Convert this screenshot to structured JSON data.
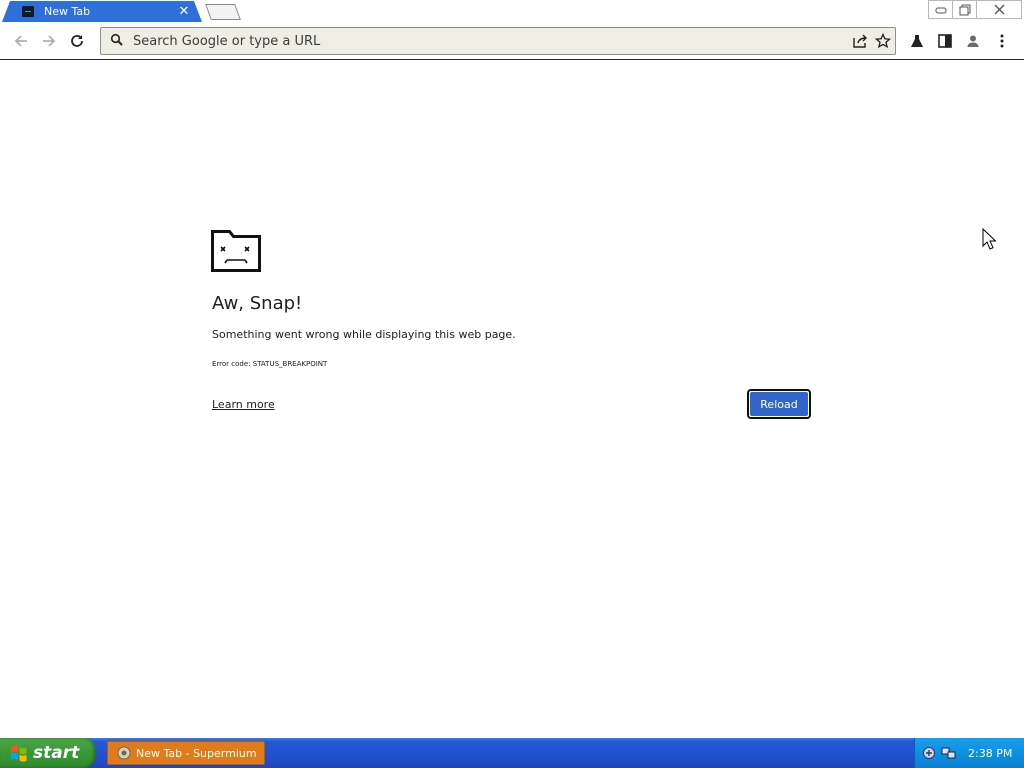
{
  "browser": {
    "tab": {
      "title": "New Tab",
      "close_symbol": "✕"
    },
    "window_controls": [
      "minimize",
      "restore",
      "close"
    ],
    "omnibox": {
      "placeholder": "Search Google or type a URL",
      "value": ""
    },
    "toolbar_icons": [
      "back-icon",
      "forward-icon",
      "reload-icon",
      "share-icon",
      "star-icon",
      "labs-flask-icon",
      "side-panel-icon",
      "profile-icon",
      "menu-icon"
    ]
  },
  "error_page": {
    "icon": "sad-folder-icon",
    "heading": "Aw, Snap!",
    "message": "Something went wrong while displaying this web page.",
    "error_code": "Error code: STATUS_BREAKPOINT",
    "learn_more": "Learn more",
    "reload_label": "Reload"
  },
  "taskbar": {
    "start_label": "start",
    "task_button": "New Tab - Supermium",
    "clock": "2:38 PM"
  },
  "colors": {
    "tab_active": "#2e6fd9",
    "reload_button": "#3166c8",
    "taskbar": "#2250d0",
    "start_button": "#3b9a38",
    "task_button": "#e07b1c",
    "tray": "#0f8fe0"
  }
}
